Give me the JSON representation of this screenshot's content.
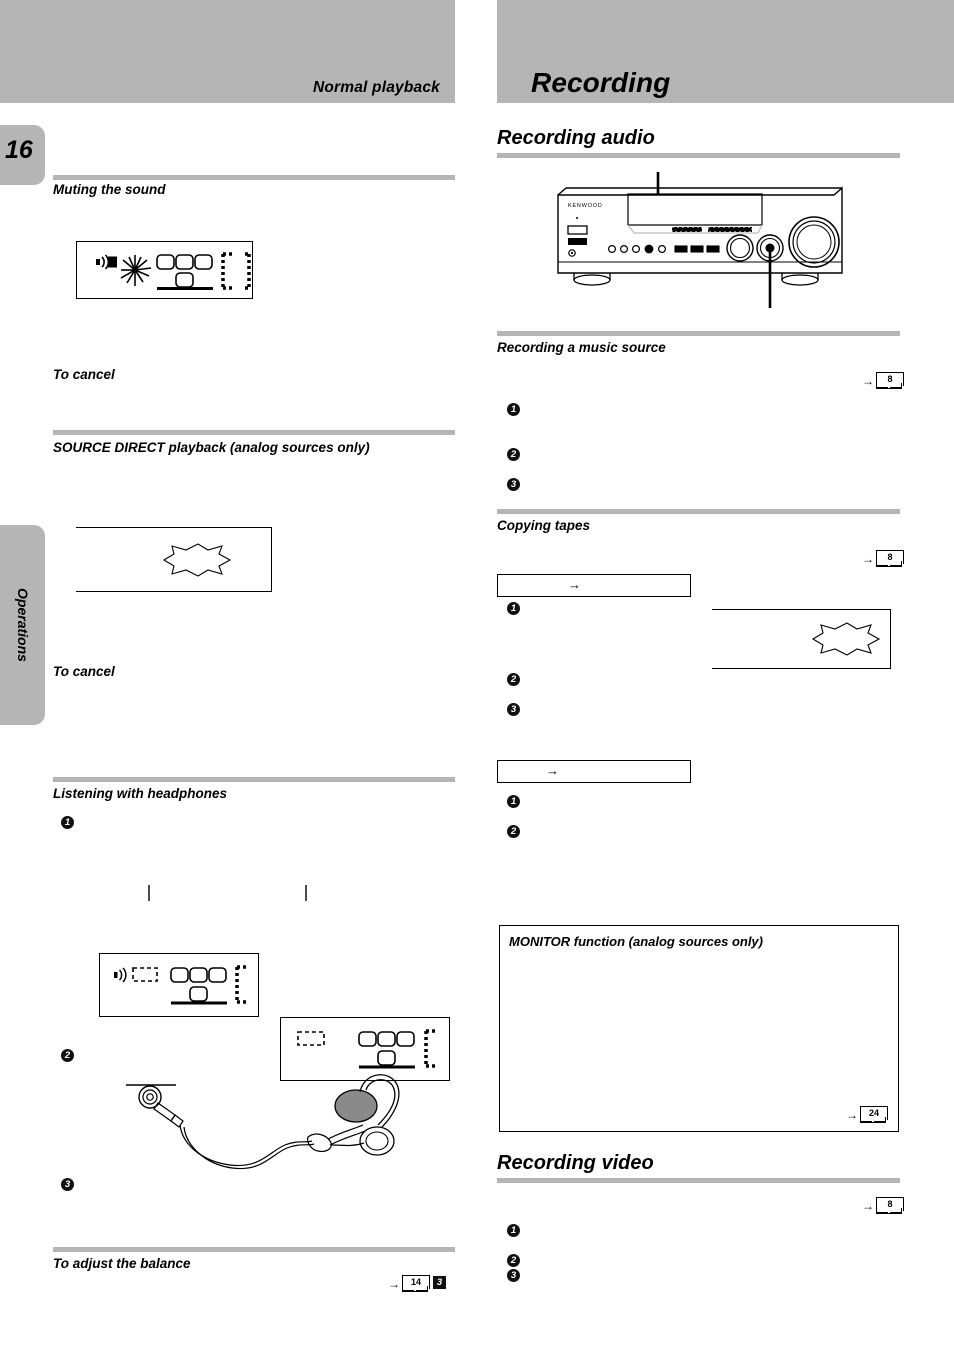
{
  "page": {
    "number": "16",
    "chapter_tab": "Operations"
  },
  "header": {
    "left_title": "Normal playback",
    "right_title": "Recording"
  },
  "left_column": {
    "sections": [
      {
        "id": "muting",
        "heading": "Muting the sound"
      },
      {
        "id": "to-cancel-1",
        "heading": "To cancel"
      },
      {
        "id": "source-direct",
        "heading": "SOURCE DIRECT playback (analog sources only)"
      },
      {
        "id": "to-cancel-2",
        "heading": "To cancel"
      },
      {
        "id": "headphones",
        "heading": "Listening with headphones"
      },
      {
        "id": "balance",
        "heading": "To adjust the balance"
      }
    ],
    "headphone_steps": [
      "1",
      "2",
      "3"
    ],
    "balance_ref": {
      "arrow": "→",
      "page": "14"
    },
    "balance_mark": "3",
    "lcd_mute": {
      "speaker_icon": "speaker-icon",
      "flash_icon": "flash-burst-icon"
    },
    "lcd_headphones": [
      {
        "speaker_icon": "speaker-icon",
        "dashed": true
      },
      {
        "speaker_icon": "",
        "dashed": true
      }
    ]
  },
  "right_column": {
    "section_audio": {
      "heading": "Recording audio"
    },
    "device": {
      "brand": "KENWOOD",
      "name": "receiver-front-panel"
    },
    "sections": [
      {
        "id": "music-source",
        "heading": "Recording a music source",
        "ref": {
          "arrow": "→",
          "page": "8"
        },
        "steps": [
          "1",
          "2",
          "3"
        ]
      },
      {
        "id": "copying-tapes",
        "heading": "Copying tapes",
        "ref": {
          "arrow": "→",
          "page": "8"
        },
        "group_a": {
          "arrow": "→",
          "steps": [
            "1",
            "2",
            "3"
          ]
        },
        "group_b": {
          "arrow": "→",
          "steps": [
            "1",
            "2"
          ]
        }
      }
    ],
    "monitor_box": {
      "title": "MONITOR function (analog sources only)",
      "ref": {
        "arrow": "→",
        "page": "24"
      }
    },
    "section_video": {
      "heading": "Recording video",
      "ref": {
        "arrow": "→",
        "page": "8"
      },
      "steps": [
        "1",
        "2",
        "3"
      ]
    }
  },
  "colors": {
    "band_gray": "#b5b5b5",
    "rule_gray": "#b5b5b5",
    "ink": "#000000",
    "paper": "#ffffff"
  }
}
